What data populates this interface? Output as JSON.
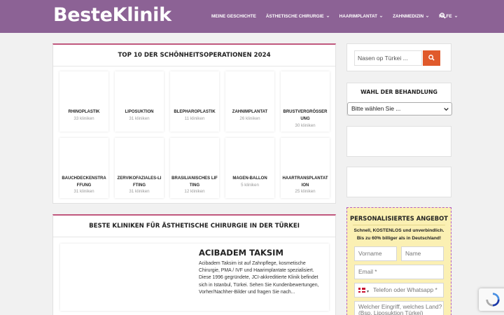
{
  "header": {
    "logo": "BesteKlinik",
    "nav": [
      {
        "label": "MEINE GESCHICHTE",
        "dropdown": false
      },
      {
        "label": "ÄSTHETISCHE CHIRURGIE",
        "dropdown": true
      },
      {
        "label": "HAARIMPLANTAT",
        "dropdown": true
      },
      {
        "label": "ZAHNMEDIZIN",
        "dropdown": true
      },
      {
        "label": "HILFE",
        "dropdown": true
      }
    ],
    "search_icon": "search-icon"
  },
  "top10": {
    "title": "TOP 10 DER SCHÖNHEITSOPERATIONEN 2024",
    "items": [
      {
        "name": "RHINOPLASTIK",
        "count": "33 kliniken"
      },
      {
        "name": "LIPOSUKTION",
        "count": "31 kliniken"
      },
      {
        "name": "BLEPHAROPLASTIK",
        "count": "11 kliniken"
      },
      {
        "name": "ZAHNIMPLANTAT",
        "count": "26 kliniken"
      },
      {
        "name": "BRUSTVERGRÖSSERUNG",
        "count": "30 kliniken"
      },
      {
        "name": "BAUCHDECKENSTRAFFUNG",
        "count": "31 kliniken"
      },
      {
        "name": "ZERVIKOFAZIALES-LIFTING",
        "count": "31 kliniken"
      },
      {
        "name": "BRASILIANISCHES LIFTING",
        "count": "12 kliniken"
      },
      {
        "name": "MAGEN-BALLON",
        "count": "5 kliniken"
      },
      {
        "name": "HAARTRANSPLANTATION",
        "count": "25 kliniken"
      }
    ]
  },
  "clinics": {
    "title": "BESTE KLINIKEN FÜR ÄSTHETISCHE CHIRURGIE IN DER TÜRKEI",
    "items": [
      {
        "name": "ACIBADEM TAKSIM",
        "description": "Acibadem Taksim ist auf Zahnpflege, kosmetische Chirurgie, PMA / IVF und Haarimplantate spezialisiert. Diese 1996 gegründete, JCI-akkreditierte Klinik befindet sich in Istanbul, Türkei. Sehen Sie Kundenbewertungen, Vorher/Nachher-Bilder und fragen Sie nach..."
      }
    ]
  },
  "sidebar": {
    "search_placeholder": "Nasen op Türkei ...",
    "wahl_title": "WAHL DER BEHANDLUNG",
    "wahl_select": "Bitte wählen Sie ...",
    "offer": {
      "title": "PERSONALISIERTES ANGEBOT",
      "subtitle": "Schnell, KOSTENLOS und unverbindlich. Bis zu 60% billiger als in Deutschland!",
      "vorname": "Vorname",
      "name": "Name",
      "email": "Email *",
      "phone": "Telefon oder Whatsapp *",
      "eingriff": "Welcher Eingriff, welches Land? (Bsp. Liposuktion Türkei)"
    }
  }
}
